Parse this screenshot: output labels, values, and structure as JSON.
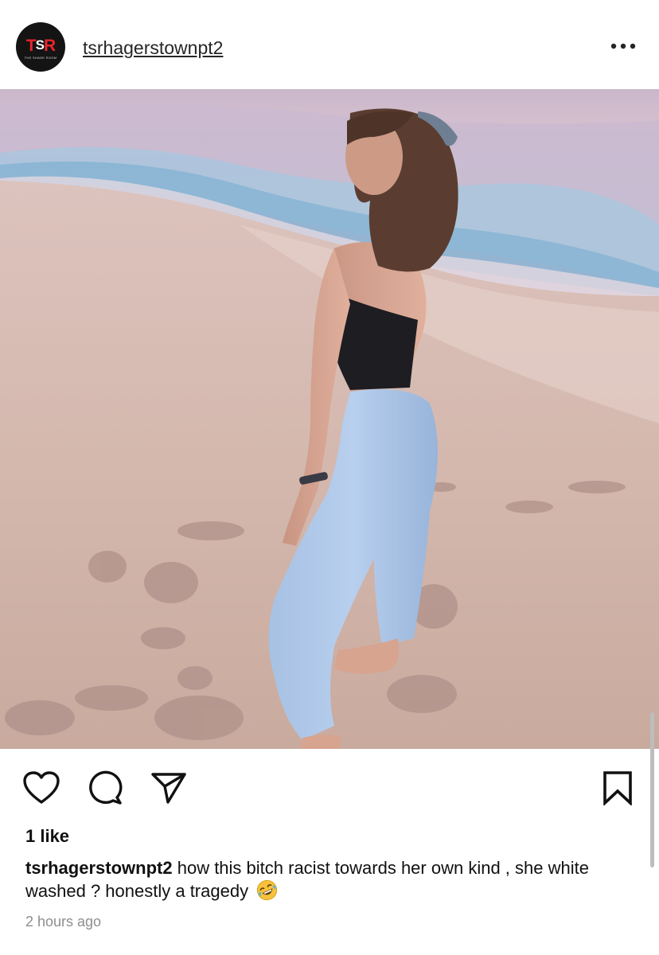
{
  "header": {
    "avatar_logo_left": "T",
    "avatar_logo_mid": "S",
    "avatar_logo_right": "R",
    "avatar_subtext": "THE SHADE ROOM",
    "username": "tsrhagerstownpt2",
    "more_icon": "more-horizontal-icon"
  },
  "photo": {
    "subject": "photo"
  },
  "actions": {
    "like_icon": "heart-icon",
    "comment_icon": "comment-icon",
    "share_icon": "paper-plane-icon",
    "save_icon": "bookmark-icon"
  },
  "post": {
    "likes": "1 like",
    "caption_user": "tsrhagerstownpt2",
    "caption_text": "how this bitch racist towards her own kind , she white washed ? honestly a tragedy",
    "caption_emoji": "rolling-on-the-floor-laughing-emoji",
    "timestamp": "2 hours ago"
  },
  "colors": {
    "avatar_bg": "#141414",
    "brand_red": "#e8262b",
    "text": "#111111",
    "muted": "#8e8e8e"
  }
}
